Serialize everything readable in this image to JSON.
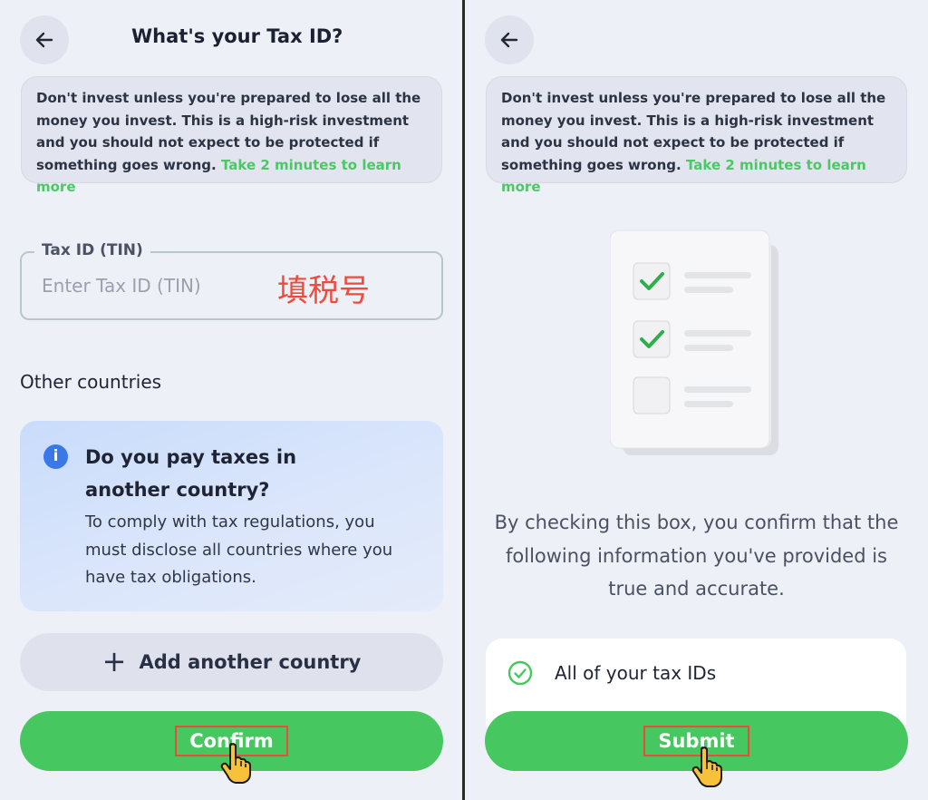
{
  "left": {
    "header": {
      "title": "What's your Tax ID?"
    },
    "warning": {
      "text": "Don't invest unless you're prepared to lose all the money you invest. This is a high-risk investment and you should not expect to be protected if something goes wrong.",
      "link": "Take 2 minutes to learn more"
    },
    "tax_field": {
      "label": "Tax ID (TIN)",
      "placeholder": "Enter Tax ID (TIN)",
      "annotation": "填税号"
    },
    "section_label": "Other countries",
    "info": {
      "title": "Do you pay taxes in another country?",
      "body": "To comply with tax regulations, you must disclose all countries where you have tax obligations."
    },
    "add_button": {
      "icon": "+",
      "label": "Add another country"
    },
    "confirm_button": {
      "label": "Confirm"
    }
  },
  "right": {
    "warning": {
      "text": "Don't invest unless you're prepared to lose all the money you invest. This is a high-risk investment and you should not expect to be protected if something goes wrong.",
      "link": "Take 2 minutes to learn more"
    },
    "consent_text": "By checking this box, you confirm that the following information you've provided is true and accurate.",
    "checklist": [
      {
        "label": "All of your tax IDs",
        "checked": true
      }
    ],
    "submit_button": {
      "label": "Submit"
    }
  },
  "colors": {
    "accent_green": "#47c760",
    "link_green": "#4bc864",
    "info_blue": "#3a78e8",
    "annotation_red": "#ef4a3c"
  }
}
